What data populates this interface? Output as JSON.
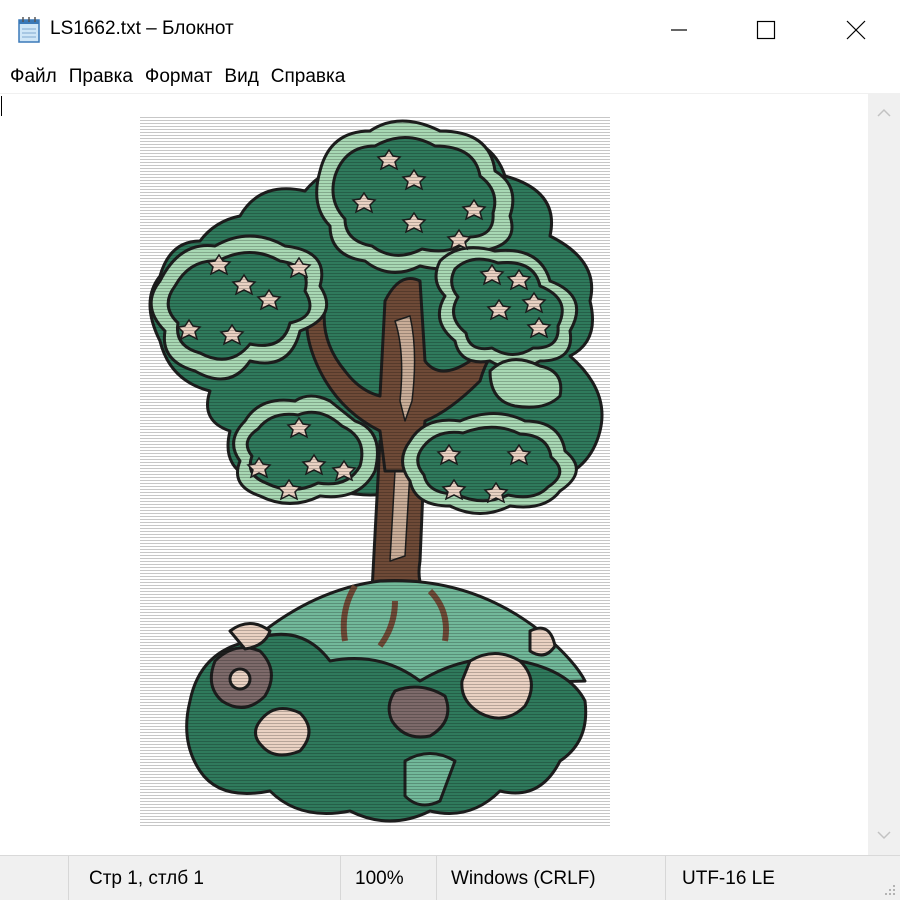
{
  "window": {
    "title": "LS1662.txt – Блокнот",
    "icon": "notepad-icon",
    "controls": [
      "minimize-icon",
      "maximize-icon",
      "close-icon"
    ]
  },
  "menu": {
    "items": [
      "Файл",
      "Правка",
      "Формат",
      "Вид",
      "Справка"
    ]
  },
  "editor": {
    "content": "ascii-art-tree",
    "colors": {
      "dark_green": "#2f7a5c",
      "light_green": "#a8d8b4",
      "trunk_brown": "#6e4a37",
      "trunk_light": "#c9ad98",
      "hill_green": "#72b99a",
      "flower_pink": "#ead2c3",
      "flower_dark": "#7d6a6a",
      "outline": "#1e1e1e"
    }
  },
  "scrollbar": {
    "up_icon": "chevron-up-icon",
    "down_icon": "chevron-down-icon"
  },
  "status": {
    "position": "Стр 1, стлб 1",
    "zoom": "100%",
    "line_endings": "Windows (CRLF)",
    "encoding": "UTF-16 LE"
  }
}
